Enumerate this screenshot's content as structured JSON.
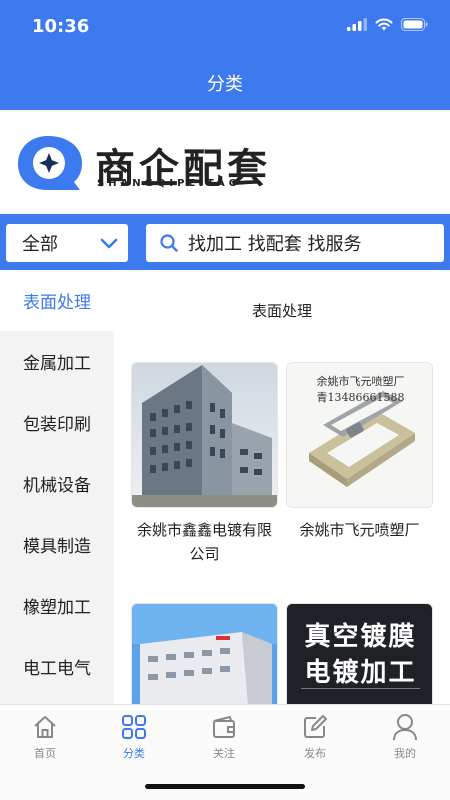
{
  "status_bar": {
    "time": "10:36"
  },
  "header": {
    "title": "分类"
  },
  "brand": {
    "name": "商企配套",
    "pinyin": "SHANGQIPEITAO"
  },
  "search": {
    "scope": "全部",
    "placeholder": "找加工 找配套 找服务"
  },
  "sidebar": {
    "items": [
      {
        "label": "表面处理",
        "active": true
      },
      {
        "label": "金属加工"
      },
      {
        "label": "包装印刷"
      },
      {
        "label": "机械设备"
      },
      {
        "label": "模具制造"
      },
      {
        "label": "橡塑加工"
      },
      {
        "label": "电工电气"
      }
    ]
  },
  "main": {
    "title": "表面处理",
    "cards": [
      {
        "name": "余姚市鑫鑫电镀有限公司",
        "icon": "factory-building-photo"
      },
      {
        "name": "余姚市飞元喷塑厂",
        "icon": "powder-coated-frame-photo",
        "photo_caption": "余姚市飞元喷塑厂",
        "photo_phone": "青13486661588"
      },
      {
        "name": "",
        "icon": "office-building-photo"
      },
      {
        "name": "",
        "icon": "vacuum-coating-banner",
        "banner_line1": "真空镀膜",
        "banner_line2": "电镀加工"
      }
    ]
  },
  "tabbar": {
    "items": [
      {
        "label": "首页",
        "icon": "home-icon"
      },
      {
        "label": "分类",
        "icon": "category-grid-icon",
        "active": true
      },
      {
        "label": "关注",
        "icon": "wallet-icon"
      },
      {
        "label": "发布",
        "icon": "edit-icon"
      },
      {
        "label": "我的",
        "icon": "user-icon"
      }
    ]
  },
  "colors": {
    "primary": "#3d79ef",
    "sidebar_bg": "#f3f3f3",
    "tab_inactive": "#888888"
  }
}
